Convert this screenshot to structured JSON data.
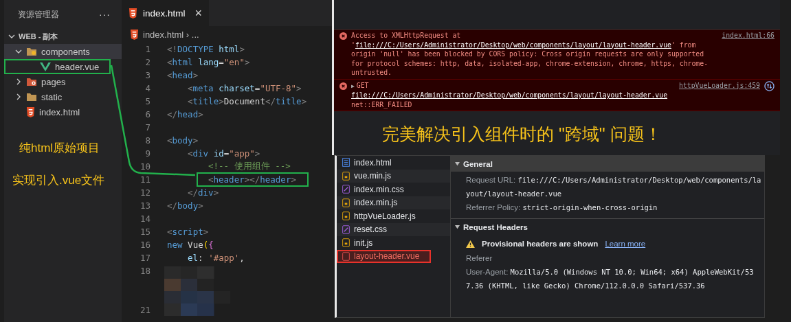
{
  "sidebar": {
    "title": "资源管理器",
    "more": "···",
    "root": {
      "label": "WEB - 副本",
      "expanded": true
    },
    "tree": [
      {
        "label": "components",
        "kind": "folder-components",
        "expanded": true,
        "selected": true,
        "highlighted": false,
        "children": [
          {
            "label": "header.vue",
            "kind": "vue",
            "selected": false,
            "highlighted": true
          }
        ]
      },
      {
        "label": "pages",
        "kind": "folder-pages",
        "expanded": false,
        "selected": false,
        "highlighted": false
      },
      {
        "label": "static",
        "kind": "folder",
        "expanded": false,
        "selected": false,
        "highlighted": false
      },
      {
        "label": "index.html",
        "kind": "html",
        "selected": false,
        "highlighted": false
      }
    ]
  },
  "annotations": [
    "纯html原始项目",
    "实现引入.vue文件"
  ],
  "editor": {
    "tab": {
      "label": "index.html",
      "close": "×"
    },
    "breadcrumb": "index.html › ...",
    "lines": [
      {
        "n": "1",
        "tokens": [
          {
            "kind": "p",
            "t": "<!"
          },
          {
            "kind": "tag",
            "t": "DOCTYPE"
          },
          {
            "kind": "attr",
            "t": " html"
          },
          {
            "kind": "p",
            "t": ">"
          }
        ]
      },
      {
        "n": "2",
        "tokens": [
          {
            "kind": "p",
            "t": "<"
          },
          {
            "kind": "tag",
            "t": "html"
          },
          {
            "kind": "attr",
            "t": " lang"
          },
          {
            "kind": "txt",
            "t": "="
          },
          {
            "kind": "str",
            "t": "\"en\""
          },
          {
            "kind": "p",
            "t": ">"
          }
        ]
      },
      {
        "n": "3",
        "tokens": [
          {
            "kind": "p",
            "t": "<"
          },
          {
            "kind": "tag",
            "t": "head"
          },
          {
            "kind": "p",
            "t": ">"
          }
        ],
        "children": [
          {
            "n": "4",
            "tokens": [
              {
                "kind": "p",
                "t": "<"
              },
              {
                "kind": "tag",
                "t": "meta"
              },
              {
                "kind": "attr",
                "t": " charset"
              },
              {
                "kind": "txt",
                "t": "="
              },
              {
                "kind": "str",
                "t": "\"UTF-8\""
              },
              {
                "kind": "p",
                "t": ">"
              }
            ]
          },
          {
            "n": "5",
            "tokens": [
              {
                "kind": "p",
                "t": "<"
              },
              {
                "kind": "tag",
                "t": "title"
              },
              {
                "kind": "p",
                "t": ">"
              },
              {
                "kind": "txt",
                "t": "Document"
              },
              {
                "kind": "p",
                "t": "</"
              },
              {
                "kind": "tag",
                "t": "title"
              },
              {
                "kind": "p",
                "t": ">"
              }
            ]
          }
        ]
      },
      {
        "n": "6",
        "tokens": [
          {
            "kind": "p",
            "t": "</"
          },
          {
            "kind": "tag",
            "t": "head"
          },
          {
            "kind": "p",
            "t": ">"
          }
        ]
      },
      {
        "n": "7"
      },
      {
        "n": "8",
        "tokens": [
          {
            "kind": "p",
            "t": "<"
          },
          {
            "kind": "tag",
            "t": "body"
          },
          {
            "kind": "p",
            "t": ">"
          }
        ],
        "children": [
          {
            "n": "9",
            "tokens": [
              {
                "kind": "p",
                "t": "<"
              },
              {
                "kind": "tag",
                "t": "div"
              },
              {
                "kind": "attr",
                "t": " id"
              },
              {
                "kind": "txt",
                "t": "="
              },
              {
                "kind": "str",
                "t": "\"app\""
              },
              {
                "kind": "p",
                "t": ">"
              }
            ],
            "children": [
              {
                "n": "10",
                "tokens": [
                  {
                    "kind": "cmt",
                    "t": "<!-- 使用组件 -->"
                  }
                ]
              },
              {
                "n": "11",
                "boxed": true,
                "tokens": [
                  {
                    "kind": "p",
                    "t": "<"
                  },
                  {
                    "kind": "tag",
                    "t": "header"
                  },
                  {
                    "kind": "p",
                    "t": "></"
                  },
                  {
                    "kind": "tag",
                    "t": "header"
                  },
                  {
                    "kind": "p",
                    "t": ">"
                  }
                ]
              }
            ]
          },
          {
            "n": "12",
            "tokens": [
              {
                "kind": "p",
                "t": "</"
              },
              {
                "kind": "tag",
                "t": "div"
              },
              {
                "kind": "p",
                "t": ">"
              }
            ]
          }
        ]
      },
      {
        "n": "13",
        "tokens": [
          {
            "kind": "p",
            "t": "</"
          },
          {
            "kind": "tag",
            "t": "body"
          },
          {
            "kind": "p",
            "t": ">"
          }
        ]
      },
      {
        "n": "14"
      },
      {
        "n": "15",
        "tokens": [
          {
            "kind": "p",
            "t": "<"
          },
          {
            "kind": "tag",
            "t": "script"
          },
          {
            "kind": "p",
            "t": ">"
          }
        ]
      },
      {
        "n": "16",
        "tokens": [
          {
            "kind": "kw",
            "t": "new"
          },
          {
            "kind": "txt",
            "t": " Vue"
          },
          {
            "kind": "br1",
            "t": "("
          },
          {
            "kind": "br2",
            "t": "{"
          }
        ],
        "children": [
          {
            "n": "17",
            "tokens": [
              {
                "kind": "attr",
                "t": "el"
              },
              {
                "kind": "txt",
                "t": ": "
              },
              {
                "kind": "str",
                "t": "'#app'"
              },
              {
                "kind": "txt",
                "t": ","
              }
            ]
          }
        ]
      },
      {
        "n": "18"
      },
      {
        "n": "21"
      }
    ]
  },
  "console": {
    "errors": [
      {
        "expandable": false,
        "before": "Access to XMLHttpRequest at '",
        "url": "file:///C:/Users/Administrator/Desktop/web/components/layout/layout-header.vue",
        "after": "' from origin 'null' has been blocked by CORS policy: Cross origin requests are only supported for protocol schemes: http, data, isolated-app, chrome-extension, chrome, https, chrome-untrusted.",
        "source": "index.html:66"
      },
      {
        "expandable": true,
        "arrow": "▶",
        "before": "GET ",
        "url": "file:///C:/Users/Administrator/Desktop/web/components/layout/layout-header.vue",
        "after": " net::ERR_FAILED",
        "source": "httpVueLoader.js:459"
      }
    ],
    "banner": "完美解决引入组件时的 \"跨域\" 问题！"
  },
  "network": {
    "files": [
      {
        "name": "index.html",
        "kind": "document",
        "failed": false,
        "selected": false
      },
      {
        "name": "vue.min.js",
        "kind": "script",
        "failed": false,
        "selected": false
      },
      {
        "name": "index.min.css",
        "kind": "stylesheet",
        "failed": false,
        "selected": false
      },
      {
        "name": "index.min.js",
        "kind": "script",
        "failed": false,
        "selected": false
      },
      {
        "name": "httpVueLoader.js",
        "kind": "script",
        "failed": false,
        "selected": false
      },
      {
        "name": "reset.css",
        "kind": "stylesheet",
        "failed": false,
        "selected": false
      },
      {
        "name": "init.js",
        "kind": "script",
        "failed": false,
        "selected": false
      },
      {
        "name": "layout-header.vue",
        "kind": "other",
        "failed": true,
        "selected": true
      }
    ],
    "sections": [
      {
        "title": "General",
        "expanded": true,
        "rows": [
          {
            "key": "Request URL:",
            "value": "file:///C:/Users/Administrator/Desktop/web/components/layout/layout-header.vue"
          },
          {
            "key": "Referrer Policy:",
            "value": "strict-origin-when-cross-origin"
          }
        ]
      },
      {
        "title": "Request Headers",
        "expanded": true,
        "warning": {
          "text": "Provisional headers are shown",
          "link": "Learn more"
        },
        "rows": [
          {
            "key": "Referer"
          },
          {
            "key": "User-Agent:",
            "value": "Mozilla/5.0 (Windows NT 10.0; Win64; x64) AppleWebKit/537.36 (KHTML, like Gecko) Chrome/112.0.0.0 Safari/537.36"
          }
        ]
      }
    ]
  }
}
